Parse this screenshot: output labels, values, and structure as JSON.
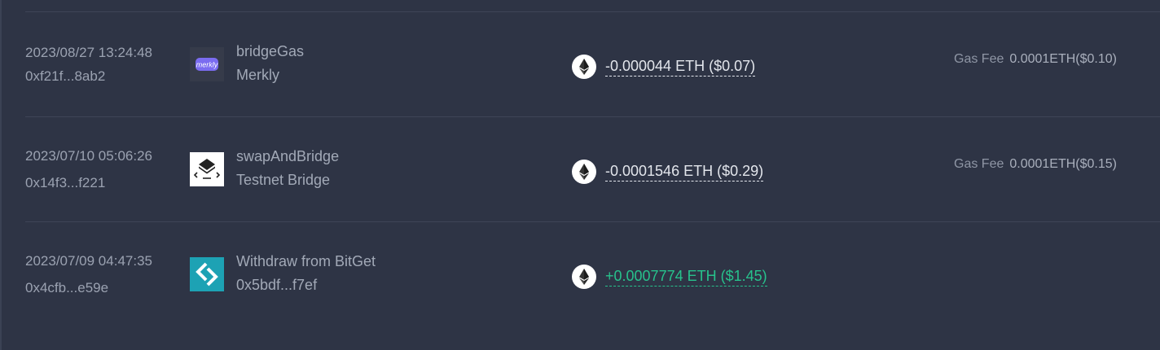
{
  "colors": {
    "background": "#2e3445",
    "divider": "#3e4557",
    "text_muted": "#9ba2b1",
    "amount_negative": "#e3e6ec",
    "amount_positive": "#27c28c"
  },
  "transactions": [
    {
      "time": "2023/08/27 13:24:48",
      "hash": "0xf21f...8ab2",
      "method": "bridgeGas",
      "protocol": "Merkly",
      "logo": "merkly-logo",
      "logo_text": "merkly",
      "token_icon": "eth-icon",
      "amount": "-0.000044 ETH ($0.07)",
      "direction": "out",
      "gas_label": "Gas Fee",
      "gas_value": "0.0001ETH($0.10)"
    },
    {
      "time": "2023/07/10 05:06:26",
      "hash": "0x14f3...f221",
      "method": "swapAndBridge",
      "protocol": "Testnet Bridge",
      "logo": "testnet-bridge-logo",
      "token_icon": "eth-icon",
      "amount": "-0.0001546 ETH ($0.29)",
      "direction": "out",
      "gas_label": "Gas Fee",
      "gas_value": "0.0001ETH($0.15)"
    },
    {
      "time": "2023/07/09 04:47:35",
      "hash": "0x4cfb...e59e",
      "method": "Withdraw from BitGet",
      "protocol": "0x5bdf...f7ef",
      "logo": "bitget-logo",
      "token_icon": "eth-icon",
      "amount": "+0.0007774 ETH ($1.45)",
      "direction": "in"
    }
  ]
}
